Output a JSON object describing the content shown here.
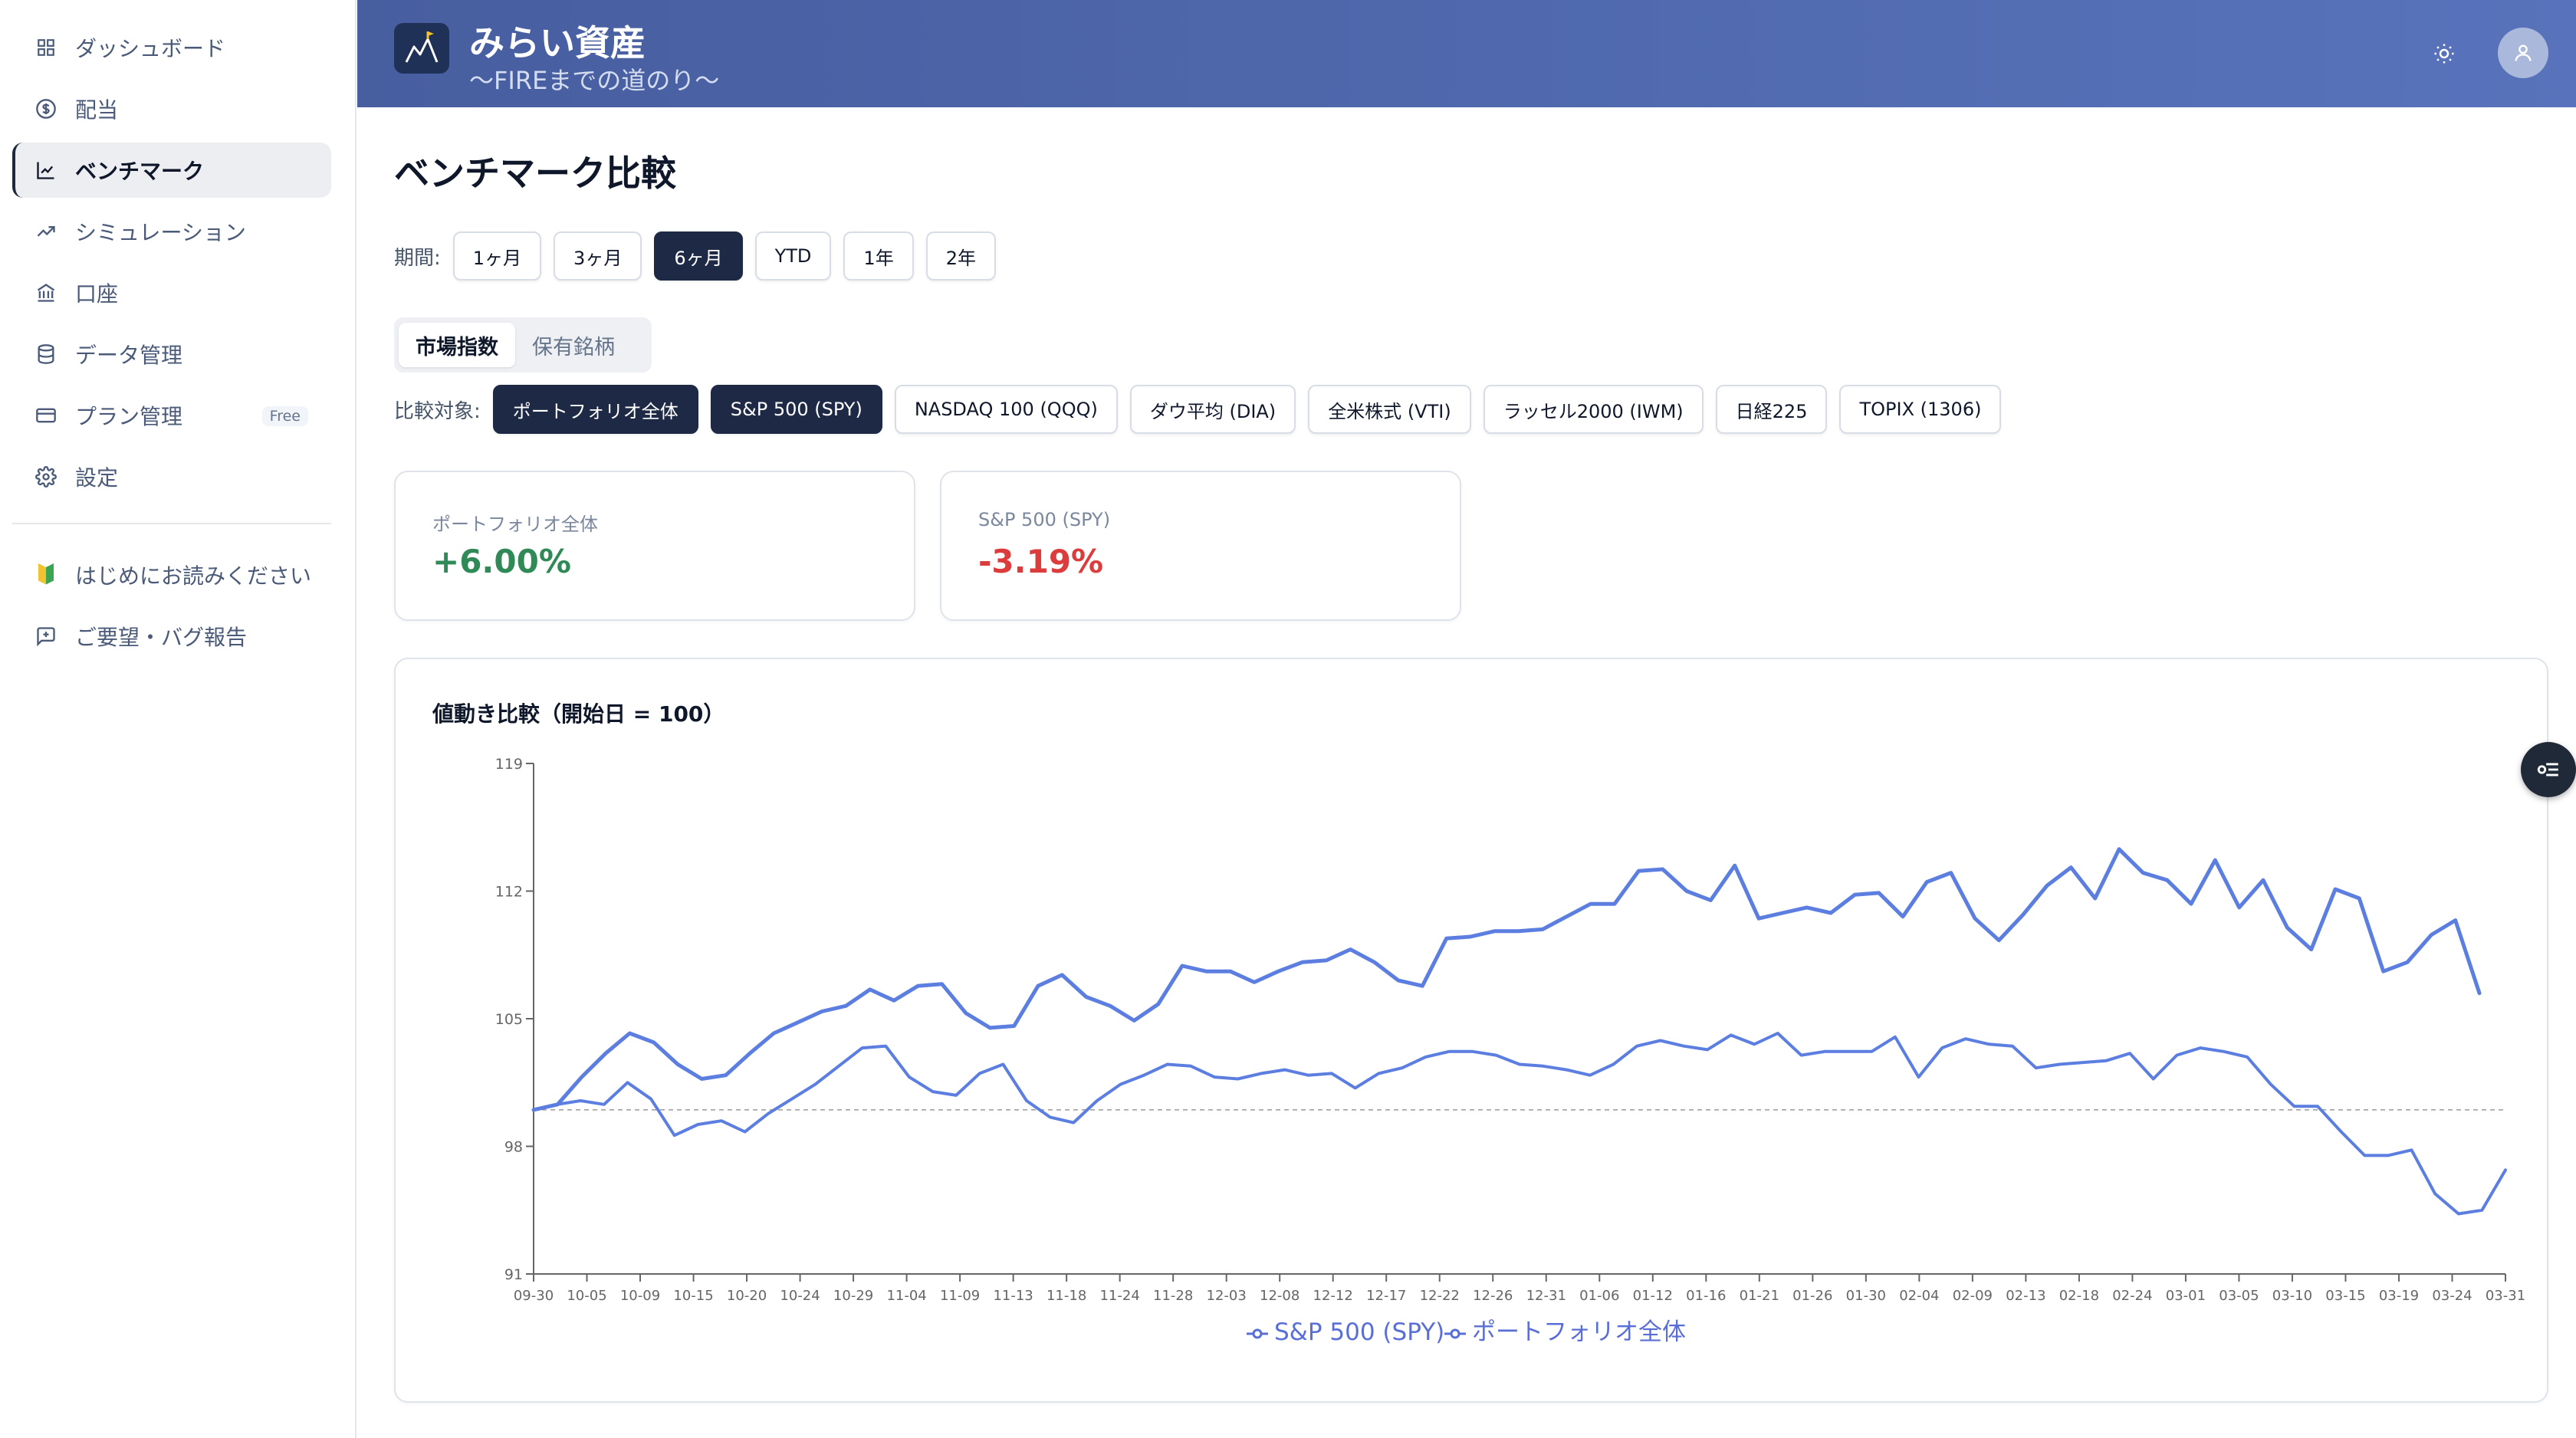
{
  "sidebar": {
    "items": [
      {
        "label": "ダッシュボード",
        "icon": "grid-icon"
      },
      {
        "label": "配当",
        "icon": "dollar-circle-icon"
      },
      {
        "label": "ベンチマーク",
        "icon": "line-chart-icon",
        "active": true
      },
      {
        "label": "シミュレーション",
        "icon": "trending-up-icon"
      },
      {
        "label": "口座",
        "icon": "bank-icon"
      },
      {
        "label": "データ管理",
        "icon": "database-icon"
      },
      {
        "label": "プラン管理",
        "icon": "credit-card-icon",
        "badge": "Free"
      },
      {
        "label": "設定",
        "icon": "gear-icon"
      }
    ],
    "secondary": [
      {
        "label": "はじめにお読みください",
        "icon": "beginner-mark-icon"
      },
      {
        "label": "ご要望・バグ報告",
        "icon": "message-plus-icon"
      }
    ]
  },
  "header": {
    "title": "みらい資産",
    "subtitle": "〜FIREまでの道のり〜"
  },
  "page": {
    "title": "ベンチマーク比較",
    "period_label": "期間:",
    "periods": [
      "1ヶ月",
      "3ヶ月",
      "6ヶ月",
      "YTD",
      "1年",
      "2年"
    ],
    "active_period": "6ヶ月",
    "tabs": [
      "市場指数",
      "保有銘柄"
    ],
    "active_tab": "市場指数",
    "compare_label": "比較対象:",
    "compare_options": [
      "ポートフォリオ全体",
      "S&P 500 (SPY)",
      "NASDAQ 100 (QQQ)",
      "ダウ平均 (DIA)",
      "全米株式 (VTI)",
      "ラッセル2000 (IWM)",
      "日経225",
      "TOPIX (1306)"
    ],
    "selected_compare": [
      "ポートフォリオ全体",
      "S&P 500 (SPY)"
    ]
  },
  "cards": [
    {
      "label": "ポートフォリオ全体",
      "value": "+6.00%",
      "color": "#2f8a57"
    },
    {
      "label": "S&P 500 (SPY)",
      "value": "-3.19%",
      "color": "#dc3c3c"
    }
  ],
  "colors": {
    "accent": "#1e2a45",
    "series_line": "#5b7ee0",
    "legend_text": "#5a6fd6",
    "positive": "#2f8a57",
    "negative": "#dc3c3c"
  },
  "chart_data": {
    "type": "line",
    "title": "値動き比較（開始日 = 100）",
    "y_ticks": [
      "119",
      "112",
      "105",
      "98",
      "91"
    ],
    "ylim": [
      91,
      119
    ],
    "baseline": 100,
    "x_ticks": [
      "09-30",
      "10-05",
      "10-09",
      "10-15",
      "10-20",
      "10-24",
      "10-29",
      "11-04",
      "11-09",
      "11-13",
      "11-18",
      "11-24",
      "11-28",
      "12-03",
      "12-08",
      "12-12",
      "12-17",
      "12-22",
      "12-26",
      "12-31",
      "01-06",
      "01-12",
      "01-16",
      "01-21",
      "01-26",
      "01-30",
      "02-04",
      "02-09",
      "02-13",
      "02-18",
      "02-24",
      "03-01",
      "03-05",
      "03-10",
      "03-15",
      "03-19",
      "03-24",
      "03-31"
    ],
    "series": [
      {
        "name": "S&P 500 (SPY)",
        "values": [
          100,
          100.3,
          100.5,
          100.3,
          101.5,
          100.6,
          98.6,
          99.2,
          99.4,
          98.8,
          99.8,
          100.6,
          101.4,
          102.4,
          103.4,
          103.5,
          101.8,
          101.0,
          100.8,
          102.0,
          102.5,
          100.5,
          99.6,
          99.3,
          100.5,
          101.4,
          101.9,
          102.5,
          102.4,
          101.8,
          101.7,
          102.0,
          102.2,
          101.9,
          102.0,
          101.2,
          102.0,
          102.3,
          102.9,
          103.2,
          103.2,
          103.0,
          102.5,
          102.4,
          102.2,
          101.9,
          102.5,
          103.5,
          103.8,
          103.5,
          103.3,
          104.1,
          103.6,
          104.2,
          103.0,
          103.2,
          103.2,
          103.2,
          104.0,
          101.8,
          103.4,
          103.9,
          103.6,
          103.5,
          102.3,
          102.5,
          102.6,
          102.7,
          103.1,
          101.7,
          103.0,
          103.4,
          103.2,
          102.9,
          101.4,
          100.2,
          100.2,
          98.8,
          97.5,
          97.5,
          97.8,
          95.4,
          94.3,
          94.5,
          96.7
        ],
        "color": "#5b7ee0"
      },
      {
        "name": "ポートフォリオ全体",
        "values": [
          100,
          100.3,
          101.8,
          103.1,
          104.2,
          103.7,
          102.5,
          101.7,
          101.9,
          103.1,
          104.2,
          104.8,
          105.4,
          105.7,
          106.6,
          106.0,
          106.8,
          106.9,
          105.3,
          104.5,
          104.6,
          106.8,
          107.4,
          106.2,
          105.7,
          104.9,
          105.8,
          107.9,
          107.6,
          107.6,
          107.0,
          107.6,
          108.1,
          108.2,
          108.8,
          108.1,
          107.1,
          106.8,
          109.4,
          109.5,
          109.8,
          109.8,
          109.9,
          110.6,
          111.3,
          111.3,
          113.1,
          113.2,
          112.0,
          111.5,
          113.4,
          110.5,
          110.8,
          111.1,
          110.8,
          111.8,
          111.9,
          110.6,
          112.5,
          113.0,
          110.5,
          109.3,
          110.7,
          112.3,
          113.3,
          111.6,
          114.3,
          113.0,
          112.6,
          111.3,
          113.7,
          111.1,
          112.6,
          110.0,
          108.8,
          112.1,
          111.6,
          107.6,
          108.1,
          109.6,
          110.4,
          106.4
        ],
        "color": "#5b7ee0"
      }
    ]
  }
}
